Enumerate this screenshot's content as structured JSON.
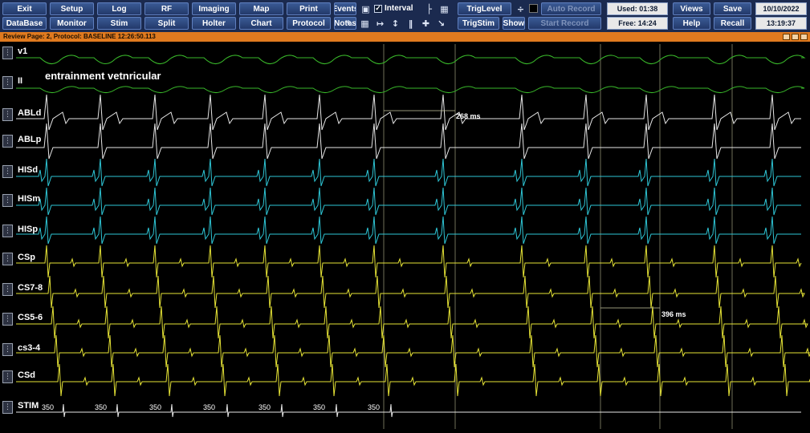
{
  "toolbar": {
    "row1": [
      "Exit",
      "Setup",
      "Log",
      "RF",
      "Imaging",
      "Map",
      "Print",
      "Events"
    ],
    "row2": [
      "DataBase",
      "Monitor",
      "Stim",
      "Split",
      "Holter",
      "Chart",
      "Protocol",
      "Notes"
    ],
    "interval_label": "Interval",
    "trig_level": "TrigLevel",
    "trig_stim": "TrigStim",
    "show": "Show",
    "auto_record": "Auto Record",
    "start_record": "Start Record",
    "used": "Used: 01:38",
    "free": "Free: 14:24",
    "views": "Views",
    "help": "Help",
    "save": "Save",
    "recall": "Recall",
    "date": "10/10/2022",
    "time": "13:19:37",
    "icons": [
      "camera-icon",
      "caliper-icon",
      "calculator-icon",
      "pen-icon",
      "grid-icon",
      "interval-icon",
      "vertical-caliper-icon",
      "marker-icon",
      "cross-icon",
      "ablation-icon"
    ]
  },
  "review_bar": "Review Page: 2, Protocol: BASELINE   12:26:50.113",
  "annotation": "entrainment vetnricular",
  "measurements": {
    "abl": "268 ms",
    "cs": "396 ms"
  },
  "channels": [
    {
      "label": "v1",
      "color": "#39b82a"
    },
    {
      "label": "II",
      "color": "#39b82a"
    },
    {
      "label": "ABLd",
      "color": "#e6e6e6"
    },
    {
      "label": "ABLp",
      "color": "#e6e6e6"
    },
    {
      "label": "HISd",
      "color": "#2ec6d6"
    },
    {
      "label": "HISm",
      "color": "#2ec6d6"
    },
    {
      "label": "HISp",
      "color": "#2ec6d6"
    },
    {
      "label": "CSp",
      "color": "#e6e436"
    },
    {
      "label": "CS7-8",
      "color": "#e6e436"
    },
    {
      "label": "CS5-6",
      "color": "#e6e436"
    },
    {
      "label": "cs3-4",
      "color": "#e6e436"
    },
    {
      "label": "CSd",
      "color": "#e6e436"
    },
    {
      "label": "STIM",
      "color": "#e6e6e6"
    }
  ],
  "stim_labels": [
    "350",
    "350",
    "350",
    "350",
    "350",
    "350",
    "350"
  ]
}
